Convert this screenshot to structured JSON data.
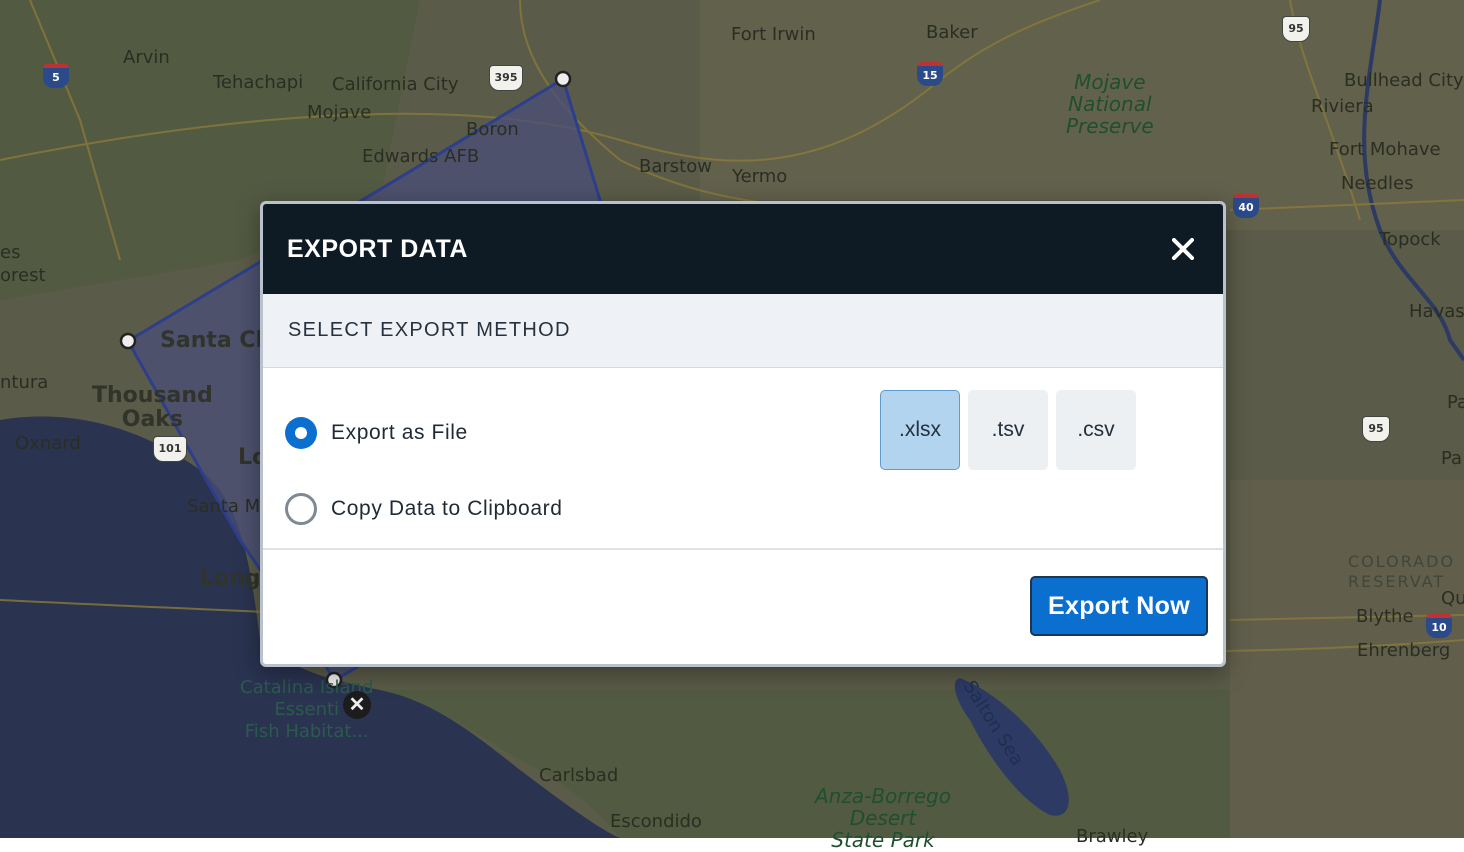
{
  "map": {
    "labels": {
      "fort_irwin": "Fort Irwin",
      "baker": "Baker",
      "arvin": "Arvin",
      "tehachapi": "Tehachapi",
      "california_city": "California City",
      "mojave": "Mojave",
      "boron": "Boron",
      "edwards_afb": "Edwards AFB",
      "barstow": "Barstow",
      "yermo": "Yermo",
      "mojave_preserve": "Mojave\nNational\nPreserve",
      "bullhead_city": "Bullhead City",
      "riviera": "Riviera",
      "fort_mohave": "Fort Mohave",
      "needles": "Needles",
      "topock": "Topock",
      "havasu": "Havas",
      "santa_clarita": "Santa Cla",
      "thousand_oaks": "Thousand\nOaks",
      "oxnard": "Oxnard",
      "ventura": "ntura",
      "es": "es",
      "orest": "orest",
      "santa_monica": "Santa M",
      "la": "Lo",
      "long_beach": "Long",
      "catalina": "Catalina Island\nEssenti\nFish Habitat...",
      "salton_sea": "Salton Sea",
      "carlsbad": "Carlsbad",
      "escondido": "Escondido",
      "anza_borrego": "Anza-Borrego\nDesert\nState Park",
      "colorado_reservation": "COLORADO\nRESERVAT",
      "blythe": "Blythe",
      "ehrenberg": "Ehrenberg",
      "qu": "Qu",
      "pa1": "Pa",
      "pa2": "Pa",
      "brawley": "Brawley"
    },
    "shields": {
      "i5": "5",
      "i15": "15",
      "i40": "40",
      "i10": "10",
      "us395": "395",
      "us95a": "95",
      "us95b": "95",
      "us101": "101"
    },
    "colors": {
      "land": "#5a5b48",
      "ocean": "#2a3350",
      "polygon_fill": "#4a4d78",
      "polygon_stroke": "#2d3f8c"
    }
  },
  "modal": {
    "title": "EXPORT DATA",
    "close_icon": "close-icon",
    "section_title": "SELECT EXPORT METHOD",
    "options": {
      "file_label": "Export as File",
      "clipboard_label": "Copy Data to Clipboard",
      "selected": "file"
    },
    "formats": {
      "xlsx": ".xlsx",
      "tsv": ".tsv",
      "csv": ".csv",
      "selected": ".xlsx"
    },
    "export_button": "Export Now",
    "colors": {
      "header_bg": "#0f1b24",
      "accent": "#0b6fd0",
      "selected_format_bg": "#b3d4ee"
    }
  }
}
